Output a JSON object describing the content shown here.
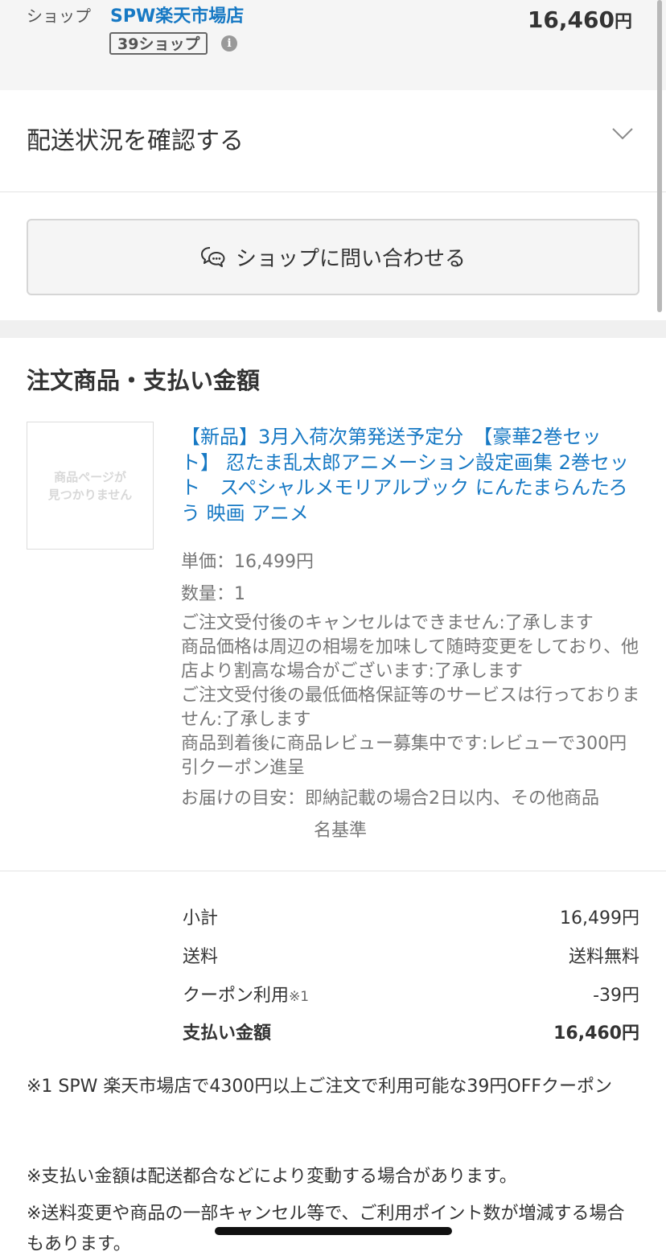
{
  "shop": {
    "label": "ショップ",
    "name": "SPW楽天市場店",
    "badge": "39ショップ",
    "info_icon": "info-icon",
    "amount": "16,460",
    "currency": "円"
  },
  "shipping": {
    "label": "配送状況を確認する",
    "icon": "chevron-down-icon"
  },
  "contact": {
    "label": "ショップに問い合わせる",
    "icon": "chat-bubbles-icon"
  },
  "order": {
    "section_title": "注文商品・支払い金額",
    "product": {
      "thumbnail_text_1": "商品ページが",
      "thumbnail_text_2": "見つかりません",
      "title": "【新品】3月入荷次第発送予定分　【豪華2巻セット】 忍たま乱太郎アニメーション設定画集 2巻セット　スペシャルメモリアルブック にんたまらんたろう 映画 アニメ",
      "unit_price": "単価：16,499円",
      "quantity": "数量：1",
      "notes": [
        "ご注文受付後のキャンセルはできません:了承します",
        "商品価格は周辺の相場を加味して随時変更をしており、他店より割高な場合がございます:了承します",
        "ご注文受付後の最低価格保証等のサービスは行っておりません:了承します",
        "商品到着後に商品レビュー募集中です:レビューで300円引クーポン進呈"
      ],
      "delivery_label": "お届けの目安：即納記載の場合2日以内、その他商品",
      "delivery_label_cont": "名基準"
    }
  },
  "summary": {
    "subtotal_label": "小計",
    "subtotal_value": "16,499円",
    "shipping_label": "送料",
    "shipping_value": "送料無料",
    "coupon_label": "クーポン利用",
    "coupon_note_mark": "※1",
    "coupon_value": "-39円",
    "total_label": "支払い金額",
    "total_value": "16,460円"
  },
  "footnotes": {
    "coupon_note": "※1 SPW 楽天市場店で4300円以上ご注文で利用可能な39円OFFクーポン",
    "change_note": "※支払い金額は配送都合などにより変動する場合があります。",
    "points_note": "※送料変更や商品の一部キャンセル等で、ご利用ポイント数が増減する場合もあります。"
  }
}
